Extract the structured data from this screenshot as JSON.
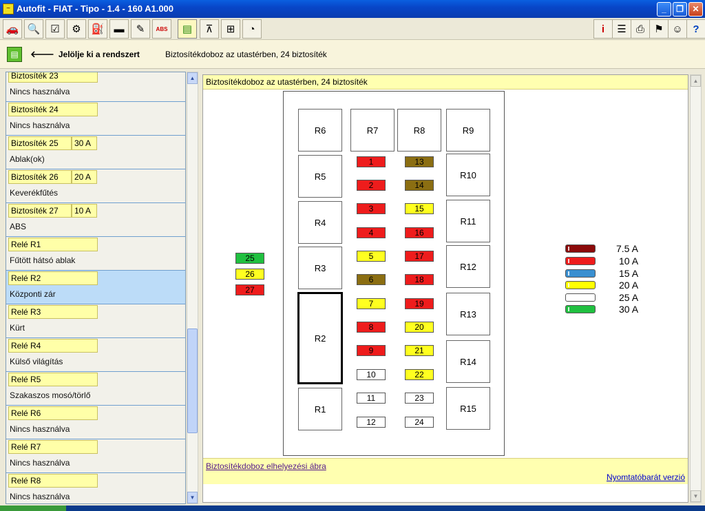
{
  "window": {
    "title": "Autofit - FIAT - Tipo - 1.4 - 160 A1.000",
    "app_icon": "autofit-logo-icon"
  },
  "toolbar": {
    "left_icons": [
      "car-icon",
      "magnifier-icon",
      "checklist-icon",
      "gearbox-icon",
      "oil-can-icon",
      "ruler-icon",
      "pencil-icon",
      "abs-icon",
      "fusebox-icon",
      "lift-icon",
      "diagnostic-icon",
      "timing-clock-icon"
    ],
    "right_icons": [
      "info-icon",
      "document-list-icon",
      "printer-icon",
      "flags-icon",
      "person-icon",
      "help-icon"
    ],
    "active_index": 8
  },
  "subheader": {
    "back_label": "Jelölje ki a rendszert",
    "breadcrumb": "Biztosítékdoboz az utastérben, 24 biztosíték"
  },
  "list": [
    {
      "name": "Biztosíték 23",
      "amp": "",
      "desc": "Nincs használva"
    },
    {
      "name": "Biztosíték 24",
      "amp": "",
      "desc": "Nincs használva"
    },
    {
      "name": "Biztosíték 25",
      "amp": "30 A",
      "desc": "Ablak(ok)"
    },
    {
      "name": "Biztosíték 26",
      "amp": "20 A",
      "desc": "Keverékfűtés"
    },
    {
      "name": "Biztosíték 27",
      "amp": "10 A",
      "desc": "ABS"
    },
    {
      "name": "Relé R1",
      "amp": "",
      "desc": "Fűtött hátsó ablak"
    },
    {
      "name": "Relé R2",
      "amp": "",
      "desc": "Központi zár",
      "selected": true
    },
    {
      "name": "Relé R3",
      "amp": "",
      "desc": "Kürt"
    },
    {
      "name": "Relé R4",
      "amp": "",
      "desc": "Külső világítás"
    },
    {
      "name": "Relé R5",
      "amp": "",
      "desc": "Szakaszos mosó/törlő"
    },
    {
      "name": "Relé R6",
      "amp": "",
      "desc": "Nincs használva"
    },
    {
      "name": "Relé R7",
      "amp": "",
      "desc": "Nincs használva"
    },
    {
      "name": "Relé R8",
      "amp": "",
      "desc": "Nincs használva"
    }
  ],
  "main": {
    "header": "Biztosítékdoboz az utastérben, 24 biztosíték",
    "footer_link": "Biztosítékdoboz elhelyezési ábra",
    "print_link": "Nyomtatóbarát verzió"
  },
  "relays": {
    "r1": "R1",
    "r2": "R2",
    "r3": "R3",
    "r4": "R4",
    "r5": "R5",
    "r6": "R6",
    "r7": "R7",
    "r8": "R8",
    "r9": "R9",
    "r10": "R10",
    "r11": "R11",
    "r12": "R12",
    "r13": "R13",
    "r14": "R14",
    "r15": "R15",
    "selected": "R2"
  },
  "fuses": [
    {
      "label": "1",
      "rating": "10 A"
    },
    {
      "label": "2",
      "rating": "10 A"
    },
    {
      "label": "3",
      "rating": "10 A"
    },
    {
      "label": "4",
      "rating": "10 A"
    },
    {
      "label": "5",
      "rating": "20 A"
    },
    {
      "label": "6",
      "rating": "7.5 A"
    },
    {
      "label": "7",
      "rating": "20 A"
    },
    {
      "label": "8",
      "rating": "10 A"
    },
    {
      "label": "9",
      "rating": "10 A"
    },
    {
      "label": "10",
      "rating": "25 A"
    },
    {
      "label": "11",
      "rating": "25 A"
    },
    {
      "label": "12",
      "rating": "25 A"
    },
    {
      "label": "13",
      "rating": "7.5 A"
    },
    {
      "label": "14",
      "rating": "7.5 A"
    },
    {
      "label": "15",
      "rating": "20 A"
    },
    {
      "label": "16",
      "rating": "10 A"
    },
    {
      "label": "17",
      "rating": "10 A"
    },
    {
      "label": "18",
      "rating": "10 A"
    },
    {
      "label": "19",
      "rating": "10 A"
    },
    {
      "label": "20",
      "rating": "20 A"
    },
    {
      "label": "21",
      "rating": "20 A"
    },
    {
      "label": "22",
      "rating": "20 A"
    },
    {
      "label": "23",
      "rating": "25 A"
    },
    {
      "label": "24",
      "rating": "25 A"
    }
  ],
  "extra_fuses": [
    {
      "label": "25",
      "rating": "30 A"
    },
    {
      "label": "26",
      "rating": "20 A"
    },
    {
      "label": "27",
      "rating": "10 A"
    }
  ],
  "legend": [
    {
      "label": "7.5 A",
      "color": "#8b0a0a"
    },
    {
      "label": "10 A",
      "color": "#ee1c1c"
    },
    {
      "label": "15 A",
      "color": "#3a8fd0"
    },
    {
      "label": "20 A",
      "color": "#ffff00"
    },
    {
      "label": "25 A",
      "color": "#ffffff"
    },
    {
      "label": "30 A",
      "color": "#20c040"
    }
  ],
  "fuse_colors": {
    "7.5 A": "#8b6e12",
    "10 A": "#ee1c1c",
    "20 A": "#ffff20",
    "25 A": "#ffffff",
    "30 A": "#20c040"
  }
}
